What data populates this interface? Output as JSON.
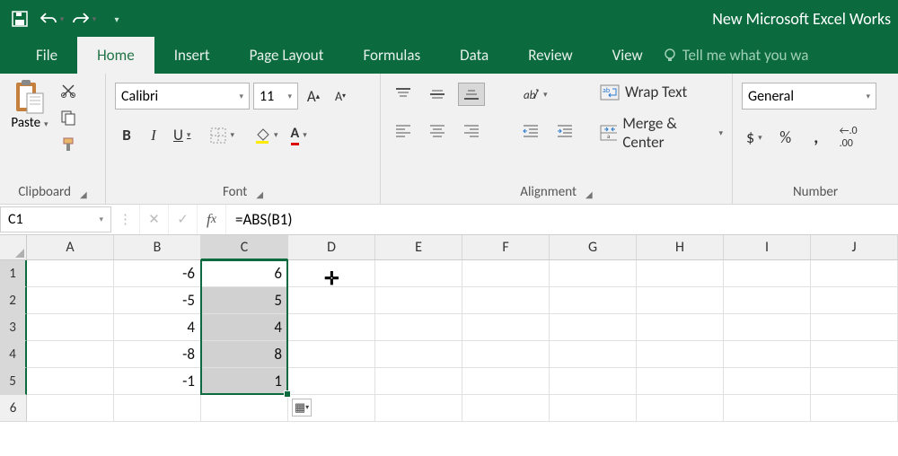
{
  "titlebar": {
    "title": "New Microsoft Excel Works"
  },
  "tabs": {
    "items": [
      {
        "label": "File"
      },
      {
        "label": "Home"
      },
      {
        "label": "Insert"
      },
      {
        "label": "Page Layout"
      },
      {
        "label": "Formulas"
      },
      {
        "label": "Data"
      },
      {
        "label": "Review"
      },
      {
        "label": "View"
      }
    ],
    "active": 1,
    "tellme": "Tell me what you wa"
  },
  "ribbon": {
    "clipboard": {
      "paste": "Paste",
      "label": "Clipboard"
    },
    "font": {
      "name": "Calibri",
      "size": "11",
      "bold": "B",
      "italic": "I",
      "underline": "U",
      "label": "Font"
    },
    "alignment": {
      "wrap": "Wrap Text",
      "merge": "Merge & Center",
      "label": "Alignment"
    },
    "number": {
      "format": "General",
      "currency": "$",
      "percent": "%",
      "comma": ",",
      "label": "Number"
    }
  },
  "formulabar": {
    "name": "C1",
    "formula": "=ABS(B1)"
  },
  "grid": {
    "columns": [
      "A",
      "B",
      "C",
      "D",
      "E",
      "F",
      "G",
      "H",
      "I",
      "J"
    ],
    "rows": [
      1,
      2,
      3,
      4,
      5,
      6
    ],
    "selectedCol": 2,
    "selectedRows": [
      0,
      1,
      2,
      3,
      4
    ],
    "B": [
      -6,
      -5,
      4,
      -8,
      -1
    ],
    "C": [
      6,
      5,
      4,
      8,
      1
    ]
  }
}
